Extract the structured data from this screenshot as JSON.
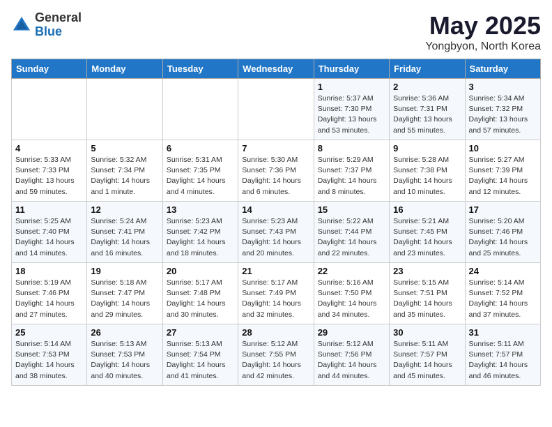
{
  "logo": {
    "general": "General",
    "blue": "Blue"
  },
  "title": "May 2025",
  "subtitle": "Yongbyon, North Korea",
  "days_of_week": [
    "Sunday",
    "Monday",
    "Tuesday",
    "Wednesday",
    "Thursday",
    "Friday",
    "Saturday"
  ],
  "weeks": [
    [
      {
        "day": "",
        "info": ""
      },
      {
        "day": "",
        "info": ""
      },
      {
        "day": "",
        "info": ""
      },
      {
        "day": "",
        "info": ""
      },
      {
        "day": "1",
        "info": "Sunrise: 5:37 AM\nSunset: 7:30 PM\nDaylight: 13 hours\nand 53 minutes."
      },
      {
        "day": "2",
        "info": "Sunrise: 5:36 AM\nSunset: 7:31 PM\nDaylight: 13 hours\nand 55 minutes."
      },
      {
        "day": "3",
        "info": "Sunrise: 5:34 AM\nSunset: 7:32 PM\nDaylight: 13 hours\nand 57 minutes."
      }
    ],
    [
      {
        "day": "4",
        "info": "Sunrise: 5:33 AM\nSunset: 7:33 PM\nDaylight: 13 hours\nand 59 minutes."
      },
      {
        "day": "5",
        "info": "Sunrise: 5:32 AM\nSunset: 7:34 PM\nDaylight: 14 hours\nand 1 minute."
      },
      {
        "day": "6",
        "info": "Sunrise: 5:31 AM\nSunset: 7:35 PM\nDaylight: 14 hours\nand 4 minutes."
      },
      {
        "day": "7",
        "info": "Sunrise: 5:30 AM\nSunset: 7:36 PM\nDaylight: 14 hours\nand 6 minutes."
      },
      {
        "day": "8",
        "info": "Sunrise: 5:29 AM\nSunset: 7:37 PM\nDaylight: 14 hours\nand 8 minutes."
      },
      {
        "day": "9",
        "info": "Sunrise: 5:28 AM\nSunset: 7:38 PM\nDaylight: 14 hours\nand 10 minutes."
      },
      {
        "day": "10",
        "info": "Sunrise: 5:27 AM\nSunset: 7:39 PM\nDaylight: 14 hours\nand 12 minutes."
      }
    ],
    [
      {
        "day": "11",
        "info": "Sunrise: 5:25 AM\nSunset: 7:40 PM\nDaylight: 14 hours\nand 14 minutes."
      },
      {
        "day": "12",
        "info": "Sunrise: 5:24 AM\nSunset: 7:41 PM\nDaylight: 14 hours\nand 16 minutes."
      },
      {
        "day": "13",
        "info": "Sunrise: 5:23 AM\nSunset: 7:42 PM\nDaylight: 14 hours\nand 18 minutes."
      },
      {
        "day": "14",
        "info": "Sunrise: 5:23 AM\nSunset: 7:43 PM\nDaylight: 14 hours\nand 20 minutes."
      },
      {
        "day": "15",
        "info": "Sunrise: 5:22 AM\nSunset: 7:44 PM\nDaylight: 14 hours\nand 22 minutes."
      },
      {
        "day": "16",
        "info": "Sunrise: 5:21 AM\nSunset: 7:45 PM\nDaylight: 14 hours\nand 23 minutes."
      },
      {
        "day": "17",
        "info": "Sunrise: 5:20 AM\nSunset: 7:46 PM\nDaylight: 14 hours\nand 25 minutes."
      }
    ],
    [
      {
        "day": "18",
        "info": "Sunrise: 5:19 AM\nSunset: 7:46 PM\nDaylight: 14 hours\nand 27 minutes."
      },
      {
        "day": "19",
        "info": "Sunrise: 5:18 AM\nSunset: 7:47 PM\nDaylight: 14 hours\nand 29 minutes."
      },
      {
        "day": "20",
        "info": "Sunrise: 5:17 AM\nSunset: 7:48 PM\nDaylight: 14 hours\nand 30 minutes."
      },
      {
        "day": "21",
        "info": "Sunrise: 5:17 AM\nSunset: 7:49 PM\nDaylight: 14 hours\nand 32 minutes."
      },
      {
        "day": "22",
        "info": "Sunrise: 5:16 AM\nSunset: 7:50 PM\nDaylight: 14 hours\nand 34 minutes."
      },
      {
        "day": "23",
        "info": "Sunrise: 5:15 AM\nSunset: 7:51 PM\nDaylight: 14 hours\nand 35 minutes."
      },
      {
        "day": "24",
        "info": "Sunrise: 5:14 AM\nSunset: 7:52 PM\nDaylight: 14 hours\nand 37 minutes."
      }
    ],
    [
      {
        "day": "25",
        "info": "Sunrise: 5:14 AM\nSunset: 7:53 PM\nDaylight: 14 hours\nand 38 minutes."
      },
      {
        "day": "26",
        "info": "Sunrise: 5:13 AM\nSunset: 7:53 PM\nDaylight: 14 hours\nand 40 minutes."
      },
      {
        "day": "27",
        "info": "Sunrise: 5:13 AM\nSunset: 7:54 PM\nDaylight: 14 hours\nand 41 minutes."
      },
      {
        "day": "28",
        "info": "Sunrise: 5:12 AM\nSunset: 7:55 PM\nDaylight: 14 hours\nand 42 minutes."
      },
      {
        "day": "29",
        "info": "Sunrise: 5:12 AM\nSunset: 7:56 PM\nDaylight: 14 hours\nand 44 minutes."
      },
      {
        "day": "30",
        "info": "Sunrise: 5:11 AM\nSunset: 7:57 PM\nDaylight: 14 hours\nand 45 minutes."
      },
      {
        "day": "31",
        "info": "Sunrise: 5:11 AM\nSunset: 7:57 PM\nDaylight: 14 hours\nand 46 minutes."
      }
    ]
  ]
}
